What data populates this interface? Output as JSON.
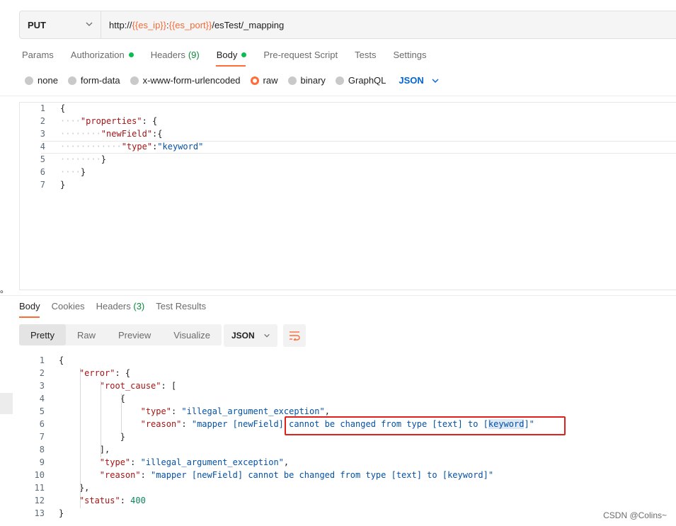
{
  "request": {
    "method": "PUT",
    "url_prefix": "http://",
    "var_ip": "{{es_ip}}",
    "url_colon": ":",
    "var_port": "{{es_port}}",
    "url_path": "/esTest/_mapping"
  },
  "request_tabs": [
    {
      "label": "Params"
    },
    {
      "label": "Authorization",
      "dot": true
    },
    {
      "label": "Headers",
      "count": "(9)"
    },
    {
      "label": "Body",
      "dot": true,
      "active": true
    },
    {
      "label": "Pre-request Script"
    },
    {
      "label": "Tests"
    },
    {
      "label": "Settings"
    }
  ],
  "body_types": [
    "none",
    "form-data",
    "x-www-form-urlencoded",
    "raw",
    "binary",
    "GraphQL"
  ],
  "body_selected": "raw",
  "body_lang": "JSON",
  "request_body_lines": [
    "{",
    "    \"properties\": {",
    "        \"newField\":{",
    "            \"type\":\"keyword\"",
    "        }",
    "    }",
    "}"
  ],
  "response_tabs": [
    {
      "label": "Body",
      "active": true
    },
    {
      "label": "Cookies"
    },
    {
      "label": "Headers",
      "count": "(3)"
    },
    {
      "label": "Test Results"
    }
  ],
  "view_modes": [
    "Pretty",
    "Raw",
    "Preview",
    "Visualize"
  ],
  "view_selected": "Pretty",
  "response_format": "JSON",
  "response_lines": [
    "{",
    "    \"error\": {",
    "        \"root_cause\": [",
    "            {",
    "                \"type\": \"illegal_argument_exception\",",
    "                \"reason\": \"mapper [newField] cannot be changed from type [text] to [keyword]\"",
    "            }",
    "        ],",
    "        \"type\": \"illegal_argument_exception\",",
    "        \"reason\": \"mapper [newField] cannot be changed from type [text] to [keyword]\"",
    "    },",
    "    \"status\": 400",
    "}"
  ],
  "left_mark": "。",
  "watermark": "CSDN @Colins~",
  "colors": {
    "accent": "#ff6c37",
    "active_dot": "#0cbb52",
    "link": "#0265d2",
    "highlight_box": "#e0201c"
  }
}
